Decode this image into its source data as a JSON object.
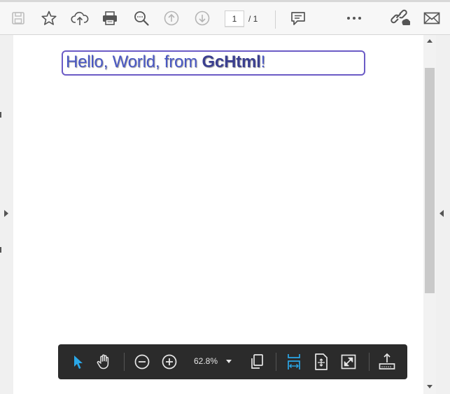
{
  "toolbar": {
    "page_current": "1",
    "page_total": "/ 1",
    "icons": [
      "save-icon",
      "bookmark-star-icon",
      "upload-cloud-icon",
      "print-icon",
      "zoom-search-icon",
      "previous-page-icon",
      "next-page-icon",
      "comment-icon",
      "more-icon",
      "link-icon",
      "mail-icon"
    ]
  },
  "document": {
    "text_prefix": "Hello, World, from ",
    "text_bold": "GcHtml",
    "text_suffix": "!"
  },
  "bottom_toolbar": {
    "zoom": "62.8%",
    "accent_color": "#2aa7e8",
    "icons": [
      "select-pointer-icon",
      "hand-tool-icon",
      "zoom-out-icon",
      "zoom-in-icon",
      "page-view-icon",
      "fit-width-icon",
      "fit-page-icon",
      "full-screen-icon",
      "export-icon"
    ]
  }
}
